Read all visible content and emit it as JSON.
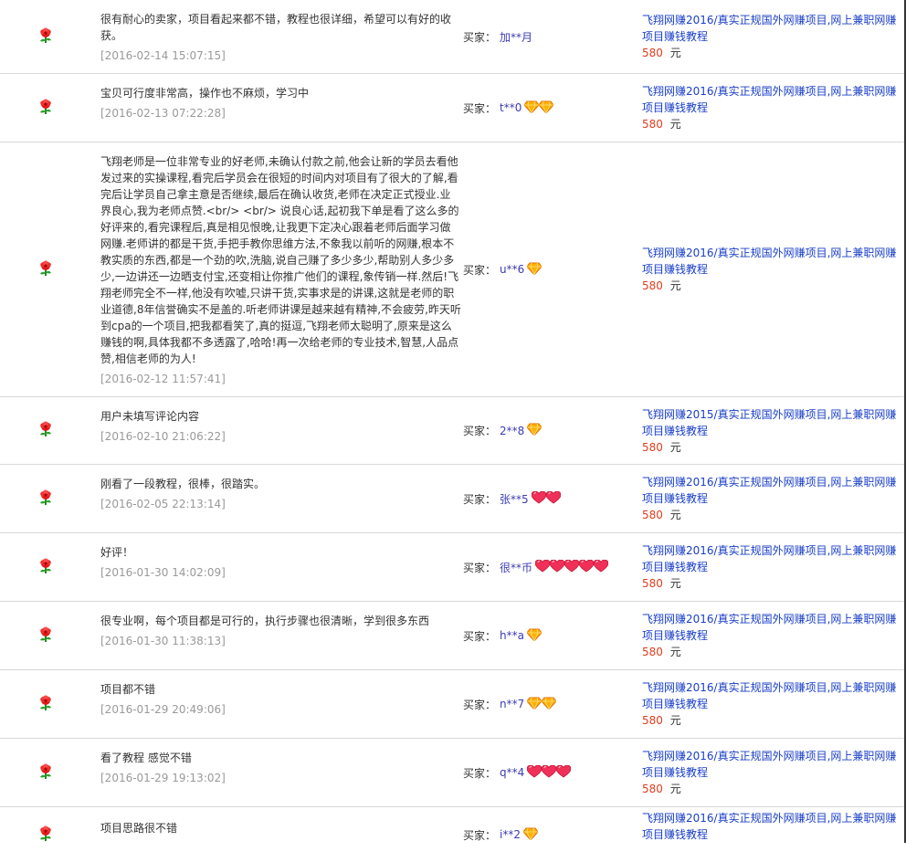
{
  "labels": {
    "buyer_label": "买家：",
    "currency_unit": "元"
  },
  "colors": {
    "link": "#1a3fc8",
    "price": "#e03c1e",
    "date": "#999999",
    "buyer_name": "#3c3cb4"
  },
  "reviews": [
    {
      "icon": "red-flower-icon",
      "comment": "很有耐心的卖家，项目看起来都不错，教程也很详细，希望可以有好的收获。",
      "date": "[2016-02-14 15:07:15]",
      "buyer": "加**月",
      "badges": [],
      "product": "飞翔网赚2016/真实正规国外网赚项目,网上兼职网赚项目赚钱教程",
      "price": "580"
    },
    {
      "icon": "red-flower-icon",
      "comment": "宝贝可行度非常高，操作也不麻烦，学习中",
      "date": "[2016-02-13 07:22:28]",
      "buyer": "t**0",
      "badges": [
        "diamond-icon",
        "diamond-icon"
      ],
      "product": "飞翔网赚2016/真实正规国外网赚项目,网上兼职网赚项目赚钱教程",
      "price": "580"
    },
    {
      "icon": "red-flower-icon",
      "comment": "飞翔老师是一位非常专业的好老师,未确认付款之前,他会让新的学员去看他发过来的实操课程,看完后学员会在很短的时间内对项目有了很大的了解,看完后让学员自己拿主意是否继续,最后在确认收货,老师在决定正式授业.业界良心,我为老师点赞.<br/> <br/> 说良心话,起初我下单是看了这么多的好评来的,看完课程后,真是相见恨晚,让我更下定决心跟着老师后面学习做网赚.老师讲的都是干货,手把手教你思维方法,不象我以前听的网赚,根本不教实质的东西,都是一个劲的吹,洗脑,说自己赚了多少多少,帮助别人多少多少,一边讲还一边晒支付宝,还变相让你推广他们的课程,象传销一样.然后!飞翔老师完全不一样,他没有吹嘘,只讲干货,实事求是的讲课,这就是老师的职业道德,8年信誉确实不是盖的.听老师讲课是越来越有精神,不会疲劳,昨天听到cpa的一个项目,把我都看笑了,真的挺逗,飞翔老师太聪明了,原来是这么赚钱的啊,具体我都不多透露了,哈哈!再一次给老师的专业技术,智慧,人品点赞,相信老师的为人!",
      "date": "[2016-02-12 11:57:41]",
      "buyer": "u**6",
      "badges": [
        "diamond-icon"
      ],
      "product": "飞翔网赚2016/真实正规国外网赚项目,网上兼职网赚项目赚钱教程",
      "price": "580"
    },
    {
      "icon": "red-flower-icon",
      "comment": "用户未填写评论内容",
      "date": "[2016-02-10 21:06:22]",
      "buyer": "2**8",
      "badges": [
        "diamond-icon"
      ],
      "product": "飞翔网赚2015/真实正规国外网赚项目,网上兼职网赚项目赚钱教程",
      "price": "580"
    },
    {
      "icon": "red-flower-icon",
      "comment": "刚看了一段教程，很棒，很踏实。",
      "date": "[2016-02-05 22:13:14]",
      "buyer": "张**5",
      "badges": [
        "heart-icon",
        "heart-icon"
      ],
      "product": "飞翔网赚2016/真实正规国外网赚项目,网上兼职网赚项目赚钱教程",
      "price": "580"
    },
    {
      "icon": "red-flower-icon",
      "comment": "好评！",
      "date": "[2016-01-30 14:02:09]",
      "buyer": "很**币",
      "badges": [
        "heart-icon",
        "heart-icon",
        "heart-icon",
        "heart-icon",
        "heart-icon"
      ],
      "product": "飞翔网赚2016/真实正规国外网赚项目,网上兼职网赚项目赚钱教程",
      "price": "580"
    },
    {
      "icon": "red-flower-icon",
      "comment": "很专业啊，每个项目都是可行的，执行步骤也很清晰，学到很多东西",
      "date": "[2016-01-30 11:38:13]",
      "buyer": "h**a",
      "badges": [
        "diamond-icon"
      ],
      "product": "飞翔网赚2016/真实正规国外网赚项目,网上兼职网赚项目赚钱教程",
      "price": "580"
    },
    {
      "icon": "red-flower-icon",
      "comment": "项目都不错",
      "date": "[2016-01-29 20:49:06]",
      "buyer": "n**7",
      "badges": [
        "diamond-icon",
        "diamond-icon"
      ],
      "product": "飞翔网赚2016/真实正规国外网赚项目,网上兼职网赚项目赚钱教程",
      "price": "580"
    },
    {
      "icon": "red-flower-icon",
      "comment": "看了教程 感觉不错",
      "date": "[2016-01-29 19:13:02]",
      "buyer": "q**4",
      "badges": [
        "heart-icon",
        "heart-icon",
        "heart-icon"
      ],
      "product": "飞翔网赚2016/真实正规国外网赚项目,网上兼职网赚项目赚钱教程",
      "price": "580"
    },
    {
      "icon": "red-flower-icon",
      "comment": "项目思路很不错",
      "date": "",
      "buyer": "i**2",
      "badges": [
        "diamond-icon"
      ],
      "product": "飞翔网赚2016/真实正规国外网赚项目,网上兼职网赚项目赚钱教程",
      "price": ""
    }
  ]
}
